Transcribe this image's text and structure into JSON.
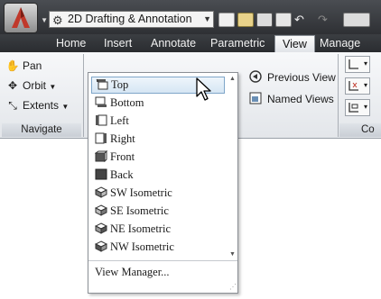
{
  "workspace": {
    "label": "2D Drafting & Annotation"
  },
  "tabs": [
    {
      "label": "Home"
    },
    {
      "label": "Insert"
    },
    {
      "label": "Annotate"
    },
    {
      "label": "Parametric"
    },
    {
      "label": "View",
      "active": true
    },
    {
      "label": "Manage"
    }
  ],
  "navigate_panel": {
    "items": [
      {
        "label": "Pan",
        "icon": "hand-icon"
      },
      {
        "label": "Orbit",
        "icon": "orbit-icon"
      },
      {
        "label": "Extents",
        "icon": "zoom-extents-icon"
      }
    ],
    "title": "Navigate"
  },
  "views_panel": {
    "previous_views": "Previous View",
    "named_views": "Named Views"
  },
  "coordinates_panel": {
    "title_partial": "Co"
  },
  "view_dropdown": {
    "items": [
      {
        "label": "Top",
        "icon": "top-view-icon",
        "selected": true
      },
      {
        "label": "Bottom",
        "icon": "bottom-view-icon"
      },
      {
        "label": "Left",
        "icon": "left-view-icon"
      },
      {
        "label": "Right",
        "icon": "right-view-icon"
      },
      {
        "label": "Front",
        "icon": "front-view-icon"
      },
      {
        "label": "Back",
        "icon": "back-view-icon"
      },
      {
        "label": "SW Isometric",
        "icon": "sw-isometric-icon"
      },
      {
        "label": "SE Isometric",
        "icon": "se-isometric-icon"
      },
      {
        "label": "NE Isometric",
        "icon": "ne-isometric-icon"
      },
      {
        "label": "NW Isometric",
        "icon": "nw-isometric-icon"
      }
    ],
    "footer": "View Manager..."
  },
  "colors": {
    "title_bar": "#2e3034",
    "selection": "#d6e6f4",
    "selection_border": "#7fa6c9"
  }
}
